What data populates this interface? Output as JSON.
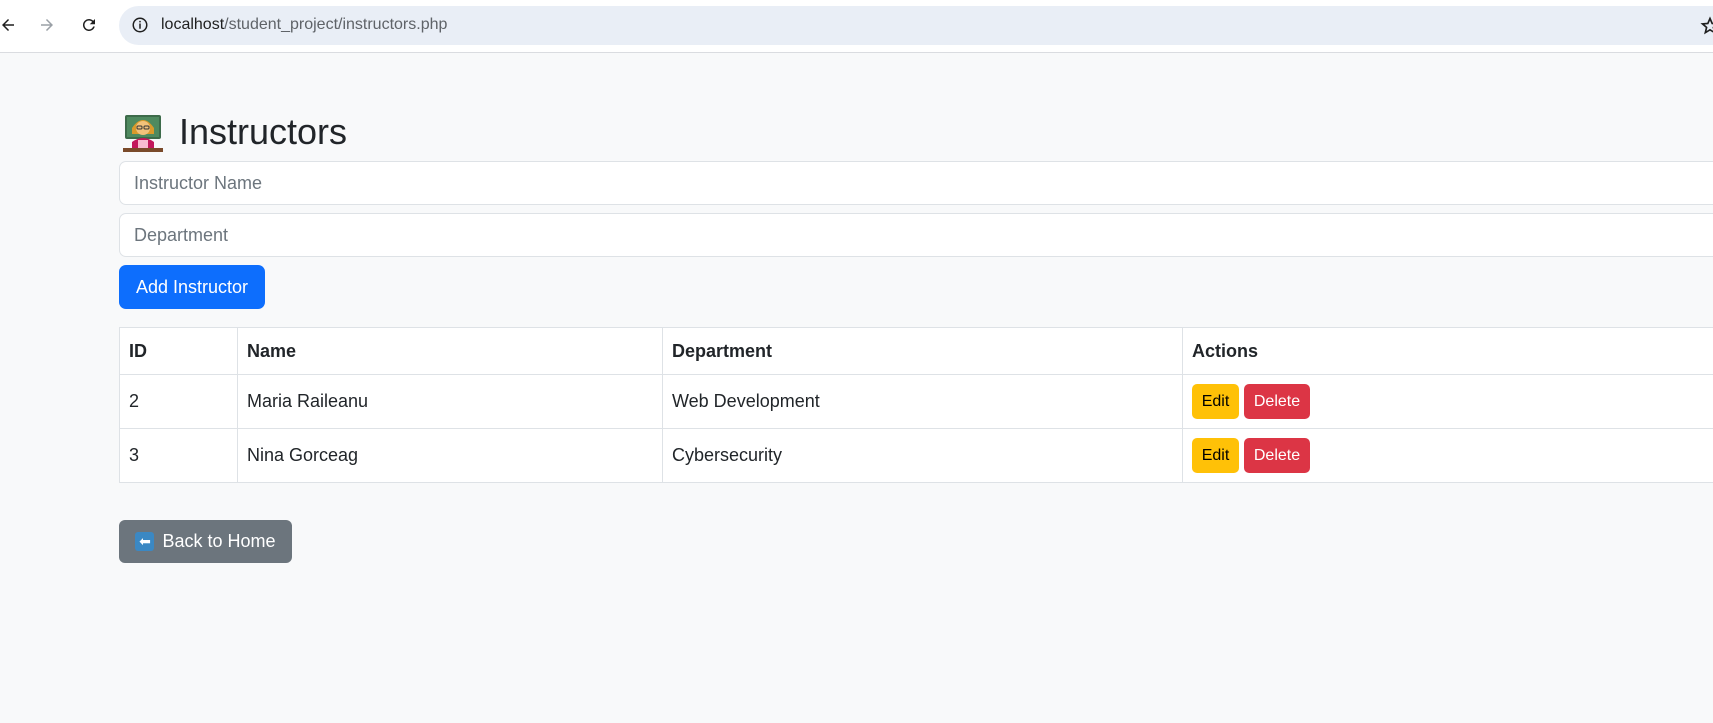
{
  "browser": {
    "url_host": "localhost",
    "url_path": "/student_project/instructors.php",
    "icons": [
      "back-icon",
      "forward-icon",
      "reload-icon",
      "site-info-icon",
      "star-icon"
    ]
  },
  "page": {
    "title": "Instructors",
    "title_icon": "teacher-icon"
  },
  "form": {
    "name_placeholder": "Instructor Name",
    "department_placeholder": "Department",
    "submit_label": "Add Instructor"
  },
  "table": {
    "headers": [
      "ID",
      "Name",
      "Department",
      "Actions"
    ],
    "rows": [
      {
        "id": "2",
        "name": "Maria Raileanu",
        "department": "Web Development",
        "edit_label": "Edit",
        "delete_label": "Delete"
      },
      {
        "id": "3",
        "name": "Nina Gorceag",
        "department": "Cybersecurity",
        "edit_label": "Edit",
        "delete_label": "Delete"
      }
    ]
  },
  "back_button": {
    "label": "Back to Home",
    "icon": "left-arrow-icon"
  },
  "colors": {
    "primary": "#0d6efd",
    "warning": "#ffc107",
    "danger": "#dc3545",
    "secondary": "#6c757d",
    "background": "#f8f9fa"
  }
}
